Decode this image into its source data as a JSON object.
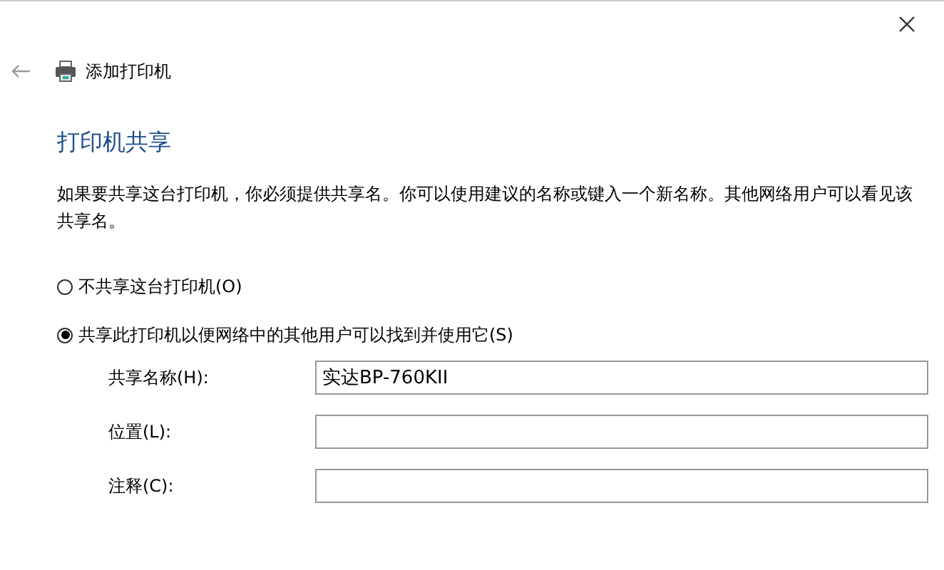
{
  "window": {
    "title": "添加打印机"
  },
  "heading": "打印机共享",
  "description": "如果要共享这台打印机，你必须提供共享名。你可以使用建议的名称或键入一个新名称。其他网络用户可以看见该共享名。",
  "options": [
    {
      "label": "不共享这台打印机(O)",
      "selected": false
    },
    {
      "label": "共享此打印机以便网络中的其他用户可以找到并使用它(S)",
      "selected": true
    }
  ],
  "fields": [
    {
      "label": "共享名称(H):",
      "value": "实达BP-760KII"
    },
    {
      "label": "位置(L):"
    },
    {
      "label": "注释(C):"
    }
  ]
}
